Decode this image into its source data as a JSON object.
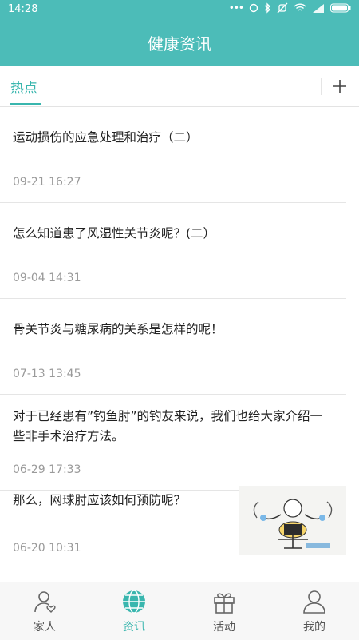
{
  "status_bar": {
    "time": "14:28"
  },
  "header": {
    "title": "健康资讯"
  },
  "tabs": {
    "active_label": "热点",
    "add_label": "+"
  },
  "news": [
    {
      "title": "运动损伤的应急处理和治疗（二）",
      "time": "09-21 16:27"
    },
    {
      "title": "怎么知道患了风湿性关节炎呢？(二）",
      "time": "09-04 14:31"
    },
    {
      "title": "骨关节炎与糖尿病的关系是怎样的呢！",
      "time": "07-13 13:45"
    },
    {
      "title": "对于已经患有”钓鱼肘”的钓友来说，我们也给大家介绍一些非手术治疗方法。",
      "time": "06-29 17:33"
    },
    {
      "title": "那么，网球肘应该如何预防呢？",
      "time": "06-20 10:31",
      "thumbnail": "exercise-illustration"
    }
  ],
  "bottom_nav": [
    {
      "label": "家人",
      "icon": "family-icon"
    },
    {
      "label": "资讯",
      "icon": "globe-icon",
      "active": true
    },
    {
      "label": "活动",
      "icon": "gift-icon"
    },
    {
      "label": "我的",
      "icon": "profile-icon"
    }
  ],
  "colors": {
    "primary": "#4cbcb8",
    "accent": "#39b6ae"
  }
}
